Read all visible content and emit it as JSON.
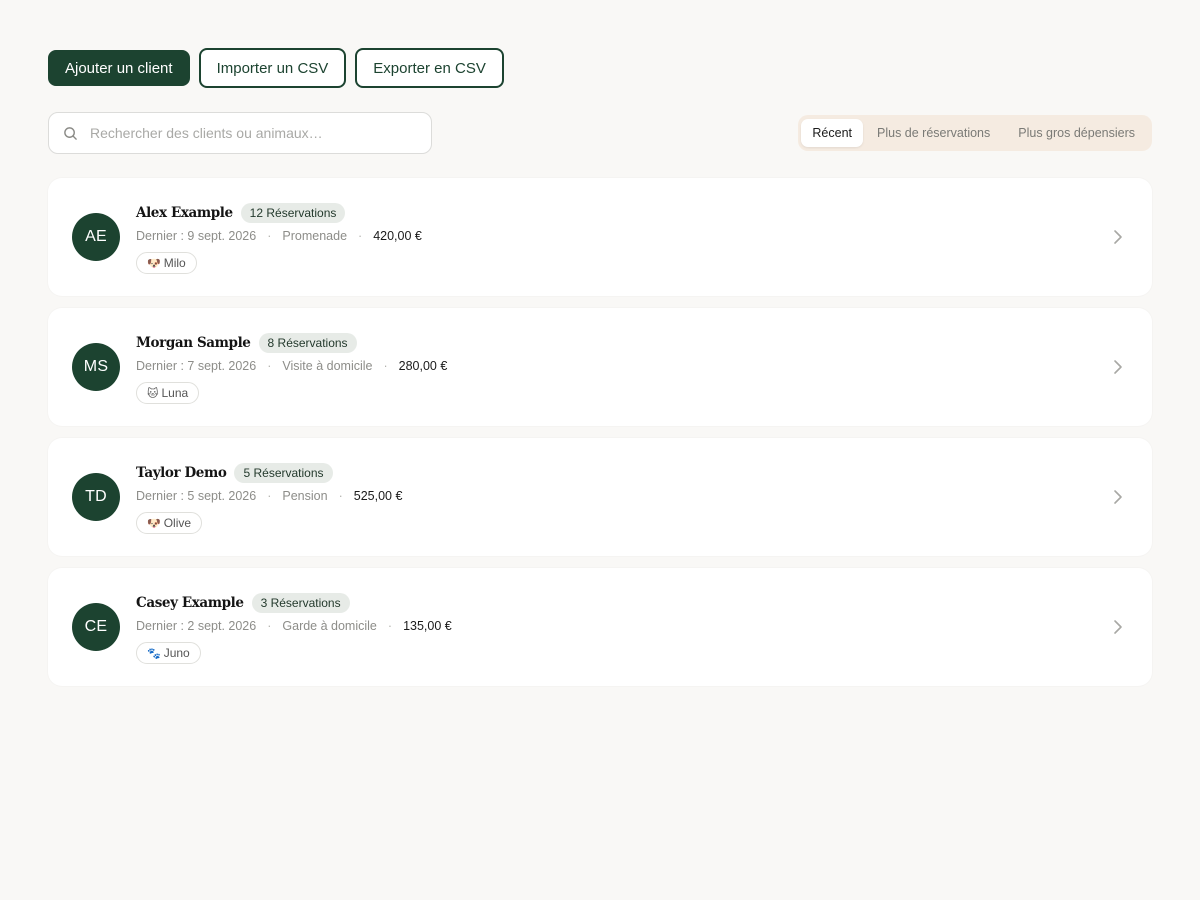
{
  "toolbar": {
    "add_client_label": "Ajouter un client",
    "import_csv_label": "Importer un CSV",
    "export_csv_label": "Exporter en CSV"
  },
  "search": {
    "placeholder": "Rechercher des clients ou animaux…",
    "value": "",
    "icon": "search-icon"
  },
  "sort_tabs": [
    {
      "label": "Récent",
      "active": true
    },
    {
      "label": "Plus de réservations",
      "active": false
    },
    {
      "label": "Plus gros dépensiers",
      "active": false
    }
  ],
  "clients": [
    {
      "initials": "AE",
      "name": "Alex Example",
      "bookings": "12 Réservations",
      "last": "Dernier : 9 sept. 2026",
      "service": "Promenade",
      "amount": "420,00 €",
      "pet": {
        "emoji": "🐶",
        "name": "Milo"
      }
    },
    {
      "initials": "MS",
      "name": "Morgan Sample",
      "bookings": "8 Réservations",
      "last": "Dernier : 7 sept. 2026",
      "service": "Visite à domicile",
      "amount": "280,00 €",
      "pet": {
        "emoji": "🐱",
        "name": "Luna"
      }
    },
    {
      "initials": "TD",
      "name": "Taylor Demo",
      "bookings": "5 Réservations",
      "last": "Dernier : 5 sept. 2026",
      "service": "Pension",
      "amount": "525,00 €",
      "pet": {
        "emoji": "🐶",
        "name": "Olive"
      }
    },
    {
      "initials": "CE",
      "name": "Casey Example",
      "bookings": "3 Réservations",
      "last": "Dernier : 2 sept. 2026",
      "service": "Garde à domicile",
      "amount": "135,00 €",
      "pet": {
        "emoji": "🐾",
        "name": "Juno"
      }
    }
  ],
  "separator": "·",
  "colors": {
    "primary": "#1c4330",
    "background": "#f9f8f6",
    "sort_tabs_bg": "#f5ebe1",
    "badge_bg": "#e7ebe7"
  }
}
